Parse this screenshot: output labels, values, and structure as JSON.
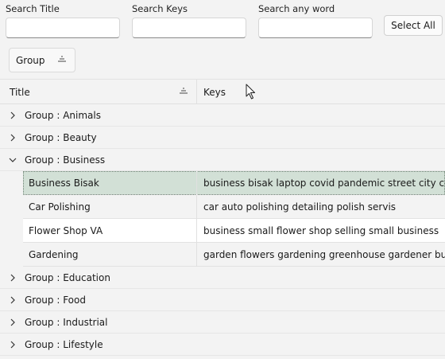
{
  "filters": [
    {
      "label": "Search Title",
      "value": "",
      "placeholder": ""
    },
    {
      "label": "Search Keys",
      "value": "",
      "placeholder": ""
    },
    {
      "label": "Search any word",
      "value": "",
      "placeholder": ""
    }
  ],
  "select_all_label": "Select All",
  "group_panel": {
    "chip_label": "Group"
  },
  "columns": [
    {
      "label": "Title",
      "sorted": "ascending"
    },
    {
      "label": "Keys"
    }
  ],
  "groups": [
    {
      "label": "Group : Animals",
      "expanded": false
    },
    {
      "label": "Group : Beauty",
      "expanded": false
    },
    {
      "label": "Group : Business",
      "expanded": true,
      "rows": [
        {
          "title": "Business Bisak",
          "keys": "business bisak laptop covid pandemic street city coffee coffee",
          "selected": true
        },
        {
          "title": "Car Polishing",
          "keys": "car auto polishing detailing polish servis"
        },
        {
          "title": "Flower Shop VA",
          "keys": "business small flower shop selling small business"
        },
        {
          "title": "Gardening",
          "keys": "garden flowers gardening greenhouse gardener business"
        }
      ]
    },
    {
      "label": "Group : Education",
      "expanded": false
    },
    {
      "label": "Group : Food",
      "expanded": false
    },
    {
      "label": "Group : Industrial",
      "expanded": false
    },
    {
      "label": "Group : Lifestyle",
      "expanded": false
    }
  ],
  "colors": {
    "selected_row": "#d2e0d6",
    "background": "#f3f3f3"
  }
}
